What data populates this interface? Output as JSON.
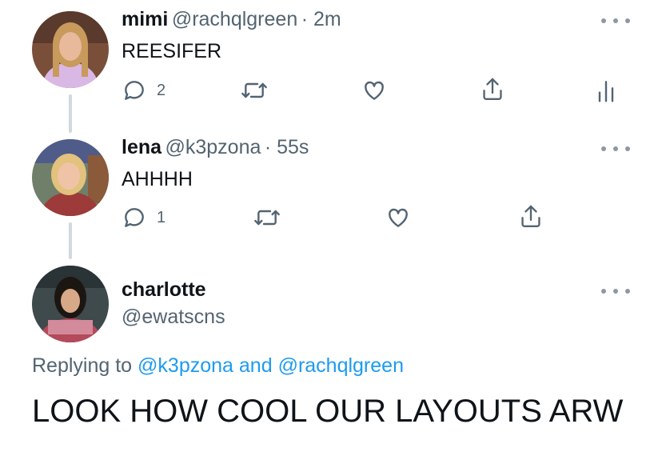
{
  "tweets": [
    {
      "name": "mimi",
      "handle": "@rachqlgreen",
      "time": "· 2m",
      "text": "REESIFER",
      "reply_count": "2",
      "avatar_colors": {
        "bg": "#7a4f3a",
        "hair": "#c89a5c",
        "face": "#e8b99a",
        "shirt": "#d9b8e6"
      }
    },
    {
      "name": "lena",
      "handle": "@k3pzona",
      "time": "· 55s",
      "text": "AHHHH",
      "reply_count": "1",
      "avatar_colors": {
        "bg": "#6f7f6a",
        "hair": "#e2c27d",
        "face": "#eec3a6",
        "shirt": "#9c3b3a"
      }
    }
  ],
  "main_tweet": {
    "name": "charlotte",
    "handle": "@ewatscns",
    "replying_prefix": "Replying to",
    "replying_user1": "@k3pzona",
    "replying_and": "and",
    "replying_user2": "@rachqlgreen",
    "text": "LOOK HOW COOL OUR LAYOUTS ARW",
    "avatar_colors": {
      "bg": "#3e4a4b",
      "hair": "#1c1612",
      "face": "#d7a988",
      "shirt": "#b44a5a"
    }
  },
  "colors": {
    "text": "#0f1419",
    "secondary": "#536471",
    "accent": "#1d9bf0",
    "thread_line": "#cfd9de"
  },
  "icons": [
    "reply-icon",
    "retweet-icon",
    "like-icon",
    "share-icon",
    "analytics-icon",
    "more-icon"
  ]
}
